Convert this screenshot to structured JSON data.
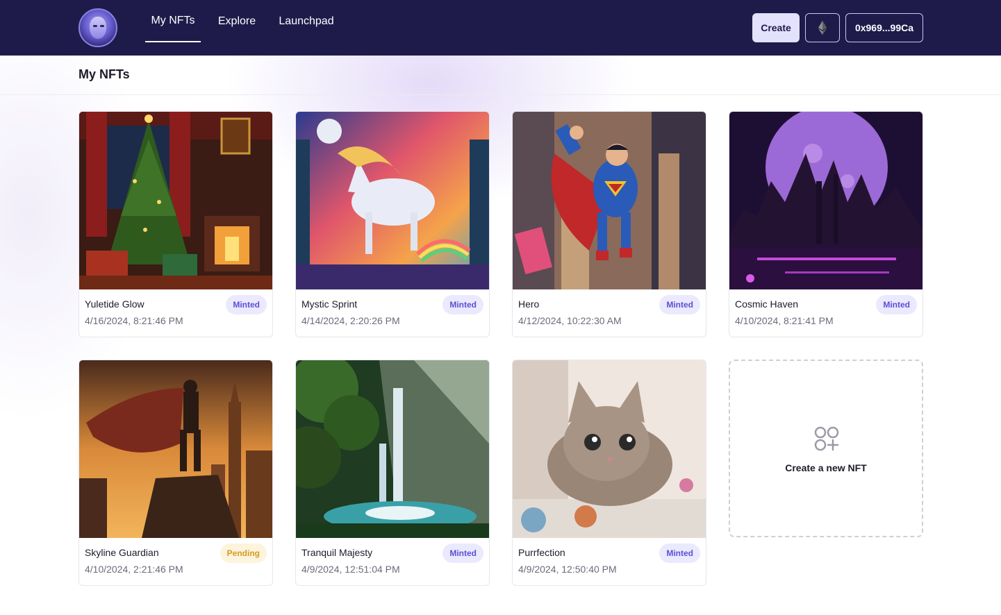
{
  "header": {
    "nav": [
      {
        "label": "My NFTs",
        "active": true
      },
      {
        "label": "Explore",
        "active": false
      },
      {
        "label": "Launchpad",
        "active": false
      }
    ],
    "create_label": "Create",
    "chain_icon": "ethereum-icon",
    "wallet_address": "0x969...99Ca"
  },
  "page": {
    "title": "My NFTs"
  },
  "nfts": [
    {
      "name": "Yuletide Glow",
      "date": "4/16/2024, 8:21:46 PM",
      "status": "Minted"
    },
    {
      "name": "Mystic Sprint",
      "date": "4/14/2024, 2:20:26 PM",
      "status": "Minted"
    },
    {
      "name": "Hero",
      "date": "4/12/2024, 10:22:30 AM",
      "status": "Minted"
    },
    {
      "name": "Cosmic Haven",
      "date": "4/10/2024, 8:21:41 PM",
      "status": "Minted"
    },
    {
      "name": "Skyline Guardian",
      "date": "4/10/2024, 2:21:46 PM",
      "status": "Pending"
    },
    {
      "name": "Tranquil Majesty",
      "date": "4/9/2024, 12:51:04 PM",
      "status": "Minted"
    },
    {
      "name": "Purrfection",
      "date": "4/9/2024, 12:50:40 PM",
      "status": "Minted"
    }
  ],
  "new_nft": {
    "label": "Create a new NFT",
    "icon": "grid-plus-icon"
  },
  "colors": {
    "header_bg": "#1e1b4b",
    "minted_badge": "#5b4fd6",
    "pending_badge": "#d59a1c"
  }
}
